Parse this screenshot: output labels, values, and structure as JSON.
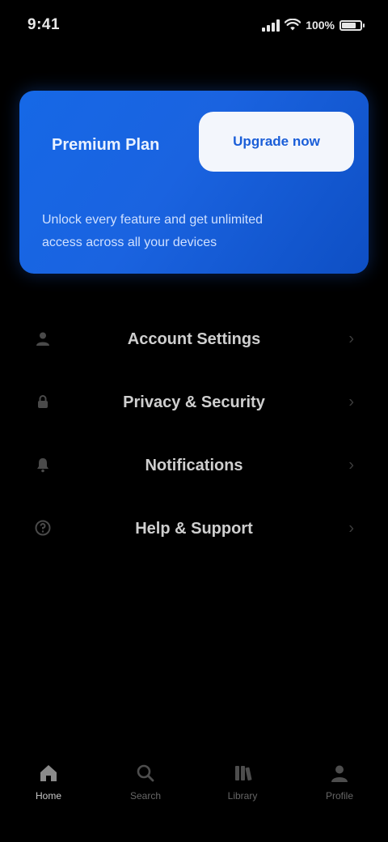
{
  "status_bar": {
    "time": "9:41",
    "battery_text": "100%"
  },
  "promo": {
    "title": "Premium Plan",
    "button_label": "Upgrade now",
    "description": "Unlock every feature and get unlimited access across all your devices"
  },
  "menu": {
    "items": [
      {
        "label": "Account Settings",
        "icon": "user-icon"
      },
      {
        "label": "Privacy & Security",
        "icon": "lock-icon"
      },
      {
        "label": "Notifications",
        "icon": "bell-icon"
      },
      {
        "label": "Help & Support",
        "icon": "help-icon"
      }
    ]
  },
  "bottom_nav": {
    "items": [
      {
        "label": "Home",
        "icon": "home-icon",
        "active": true
      },
      {
        "label": "Search",
        "icon": "search-icon",
        "active": false
      },
      {
        "label": "Library",
        "icon": "library-icon",
        "active": false
      },
      {
        "label": "Profile",
        "icon": "profile-icon",
        "active": false
      }
    ]
  },
  "colors": {
    "background": "#000000",
    "promo_blue": "#1668e6",
    "promo_button": "#f3f6fc"
  }
}
